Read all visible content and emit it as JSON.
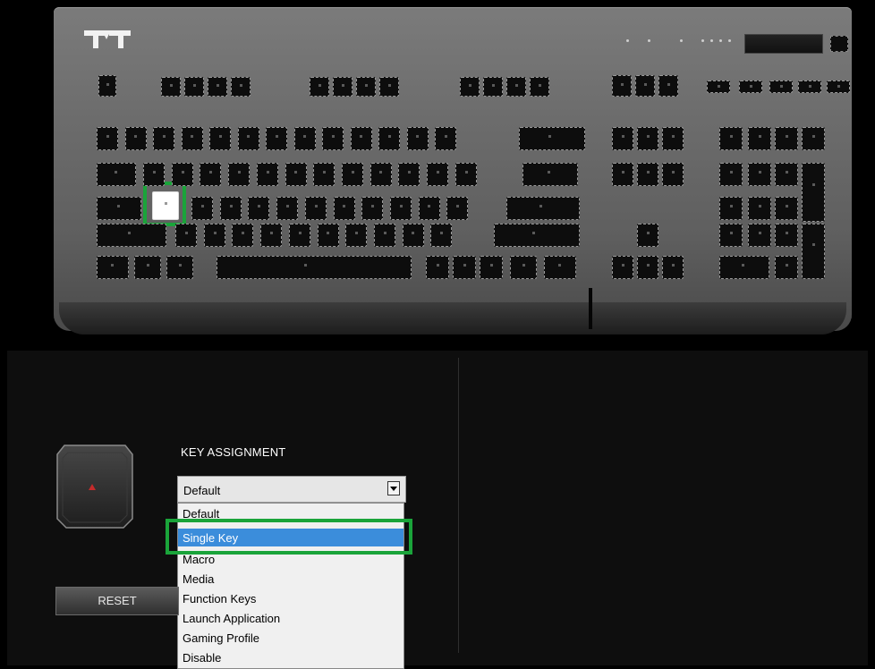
{
  "key_assignment": {
    "label": "KEY ASSIGNMENT",
    "selected_value": "Default",
    "options": [
      {
        "label": "Default"
      },
      {
        "label": "Single Key"
      },
      {
        "label": "Macro"
      },
      {
        "label": "Media"
      },
      {
        "label": "Function Keys"
      },
      {
        "label": "Launch Application"
      },
      {
        "label": "Gaming Profile"
      },
      {
        "label": "Disable"
      }
    ],
    "highlighted_option": "Single Key"
  },
  "reset_button": {
    "label": "RESET"
  },
  "colors": {
    "highlight_outline": "#1aa43a",
    "option_highlight": "#3b8ddb",
    "key_preview_glyph": "#c42b2b"
  },
  "icons": {
    "brand": "thermaltake-logo-icon",
    "dropdown": "chevron-down-icon",
    "key_preview": "key-preview-icon"
  }
}
